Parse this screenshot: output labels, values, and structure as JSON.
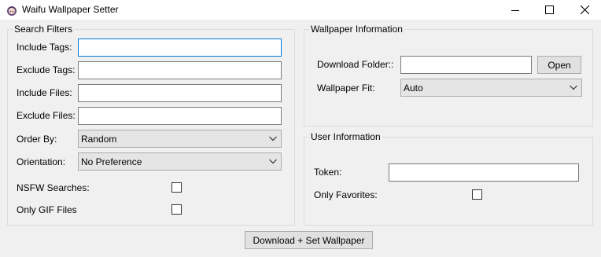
{
  "window": {
    "title": "Waifu Wallpaper Setter"
  },
  "search_filters": {
    "title": "Search Filters",
    "include_tags_label": "Include Tags:",
    "include_tags_value": "",
    "exclude_tags_label": "Exclude Tags:",
    "exclude_tags_value": "",
    "include_files_label": "Include Files:",
    "include_files_value": "",
    "exclude_files_label": "Exclude Files:",
    "exclude_files_value": "",
    "order_by_label": "Order By:",
    "order_by_value": "Random",
    "orientation_label": "Orientation:",
    "orientation_value": "No Preference",
    "nsfw_label": "NSFW Searches:",
    "nsfw_checked": false,
    "gif_label": "Only GIF Files",
    "gif_checked": false
  },
  "wallpaper_info": {
    "title": "Wallpaper Information",
    "download_folder_label": "Download Folder::",
    "download_folder_value": "",
    "open_button": "Open",
    "fit_label": "Wallpaper Fit:",
    "fit_value": "Auto"
  },
  "user_info": {
    "title": "User Information",
    "token_label": "Token:",
    "token_value": "",
    "favorites_label": "Only Favorites:",
    "favorites_checked": false
  },
  "actions": {
    "download_button": "Download + Set Wallpaper"
  }
}
